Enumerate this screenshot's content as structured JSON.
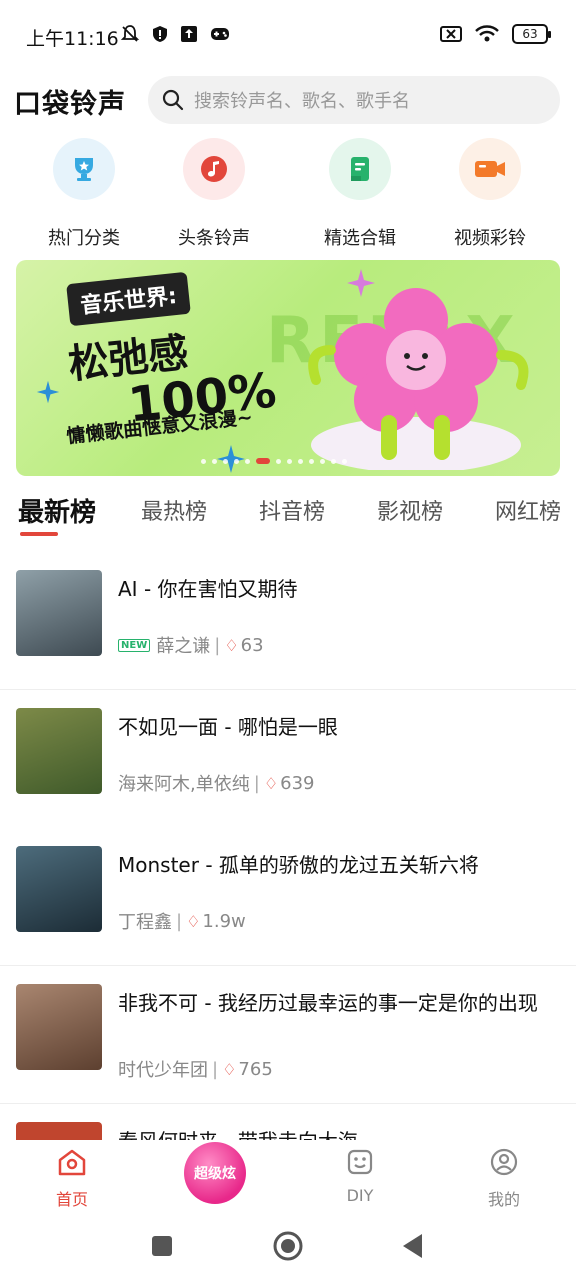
{
  "status_bar": {
    "time": "上午11:16",
    "battery": "63"
  },
  "header": {
    "app_name": "口袋铃声",
    "search_placeholder": "搜索铃声名、歌名、歌手名"
  },
  "categories": [
    {
      "label": "热门分类",
      "icon": "trophy-icon",
      "bg": "#e6f3fb",
      "color": "#36a9e1"
    },
    {
      "label": "头条铃声",
      "icon": "music-note-icon",
      "bg": "#fde9e9",
      "color": "#e2463b"
    },
    {
      "label": "精选合辑",
      "icon": "album-book-icon",
      "bg": "#e4f6ec",
      "color": "#27b26c"
    },
    {
      "label": "视频彩铃",
      "icon": "video-camera-icon",
      "bg": "#fdf0e6",
      "color": "#f37a2a"
    }
  ],
  "banner": {
    "tag": "音乐世界:",
    "line1": "松弛感",
    "line2": "100%",
    "line3": "慵懒歌曲惬意又浪漫~",
    "watermark": "RELAX",
    "dot_count": 13,
    "active_dot": 5
  },
  "tabs": [
    "最新榜",
    "最热榜",
    "抖音榜",
    "影视榜",
    "网红榜"
  ],
  "songs": [
    {
      "title": "AI - 你在害怕又期待",
      "artist": "薛之谦",
      "plays": "63",
      "new": true,
      "cover": "#5f6f77"
    },
    {
      "title": "不如见一面 - 哪怕是一眼",
      "artist": "海来阿木,单依纯",
      "plays": "639",
      "new": false,
      "cover": "#6d7a44"
    },
    {
      "title": "Monster - 孤单的骄傲的龙过五关斩六将",
      "artist": "丁程鑫",
      "plays": "1.9w",
      "new": false,
      "cover": "#2f4a5a"
    },
    {
      "title": "非我不可 - 我经历过最幸运的事一定是你的出现",
      "artist": "时代少年团",
      "plays": "765",
      "new": false,
      "cover": "#8a6a55"
    },
    {
      "title": "春风何时来 - 带我走向大海",
      "artist": "",
      "plays": "",
      "new": false,
      "cover": "#c0452e"
    }
  ],
  "new_badge": "NEW",
  "bottom_nav": {
    "home": "首页",
    "super": "超级炫",
    "diy": "DIY",
    "mine": "我的"
  }
}
